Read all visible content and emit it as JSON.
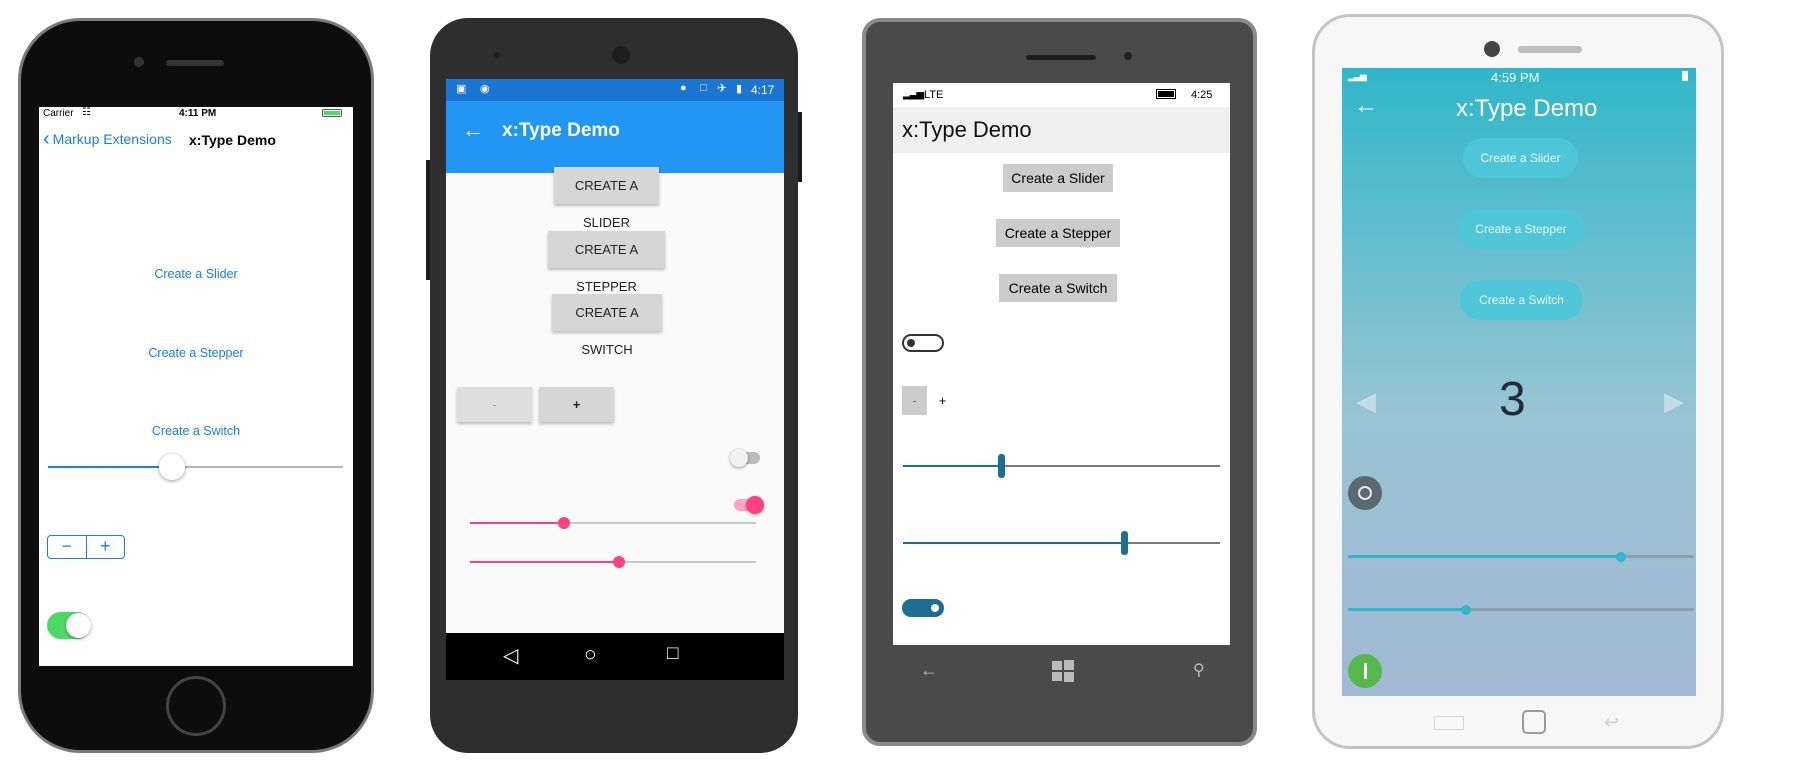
{
  "ios": {
    "status": {
      "carrier": "Carrier",
      "time": "4:11 PM"
    },
    "nav": {
      "back_label": "Markup Extensions",
      "title": "x:Type Demo"
    },
    "buttons": [
      "Create a Slider",
      "Create a Stepper",
      "Create a Switch"
    ],
    "slider_value": 0.42,
    "stepper": {
      "minus": "−",
      "plus": "+"
    },
    "switch_on": true
  },
  "android": {
    "status": {
      "time": "4:17"
    },
    "title": "x:Type Demo",
    "buttons": [
      "CREATE A SLIDER",
      "CREATE A STEPPER",
      "CREATE A SWITCH"
    ],
    "stepper": {
      "minus": "-",
      "plus": "+"
    },
    "switches": [
      false,
      true
    ],
    "sliders": [
      0.33,
      0.52
    ],
    "accent": "#ff4081",
    "appbar_color": "#2196f3"
  },
  "windows": {
    "status": {
      "signal": "LTE",
      "time": "4:25"
    },
    "title": "x:Type Demo",
    "buttons": [
      "Create a Slider",
      "Create a Stepper",
      "Create a Switch"
    ],
    "stepper": {
      "minus": "-",
      "plus": "+"
    },
    "sliders": [
      0.31,
      0.7
    ],
    "switches": [
      false,
      true
    ],
    "accent": "#1c6f93"
  },
  "tizen": {
    "status": {
      "time": "4:59 PM"
    },
    "title": "x:Type Demo",
    "buttons": [
      "Create a Slider",
      "Create a Stepper",
      "Create a Switch"
    ],
    "stepper_value": "3",
    "sliders": [
      0.79,
      0.34
    ],
    "switches": [
      false,
      true
    ],
    "accent": "#2fb7c9"
  }
}
